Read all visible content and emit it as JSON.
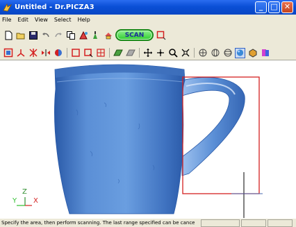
{
  "window": {
    "title": "Untitled - Dr.PICZA3",
    "minimize_label": "_",
    "maximize_label": "□",
    "close_label": "✕"
  },
  "menu": {
    "items": [
      {
        "label": "File"
      },
      {
        "label": "Edit"
      },
      {
        "label": "View"
      },
      {
        "label": "Select"
      },
      {
        "label": "Help"
      }
    ]
  },
  "toolbar": {
    "scan_label": "SCAN"
  },
  "axes": {
    "z_label": "Z",
    "y_label": "Y",
    "x_label": "X"
  },
  "status": {
    "message": "Specify the area, then perform scanning. The last range specified can be cance"
  },
  "colors": {
    "mug_fill": "#5b8fd6",
    "selection_rect": "#d42020",
    "axis_z": "#2f8f2f",
    "axis_y": "#2fbf2f",
    "axis_x": "#d42020"
  }
}
